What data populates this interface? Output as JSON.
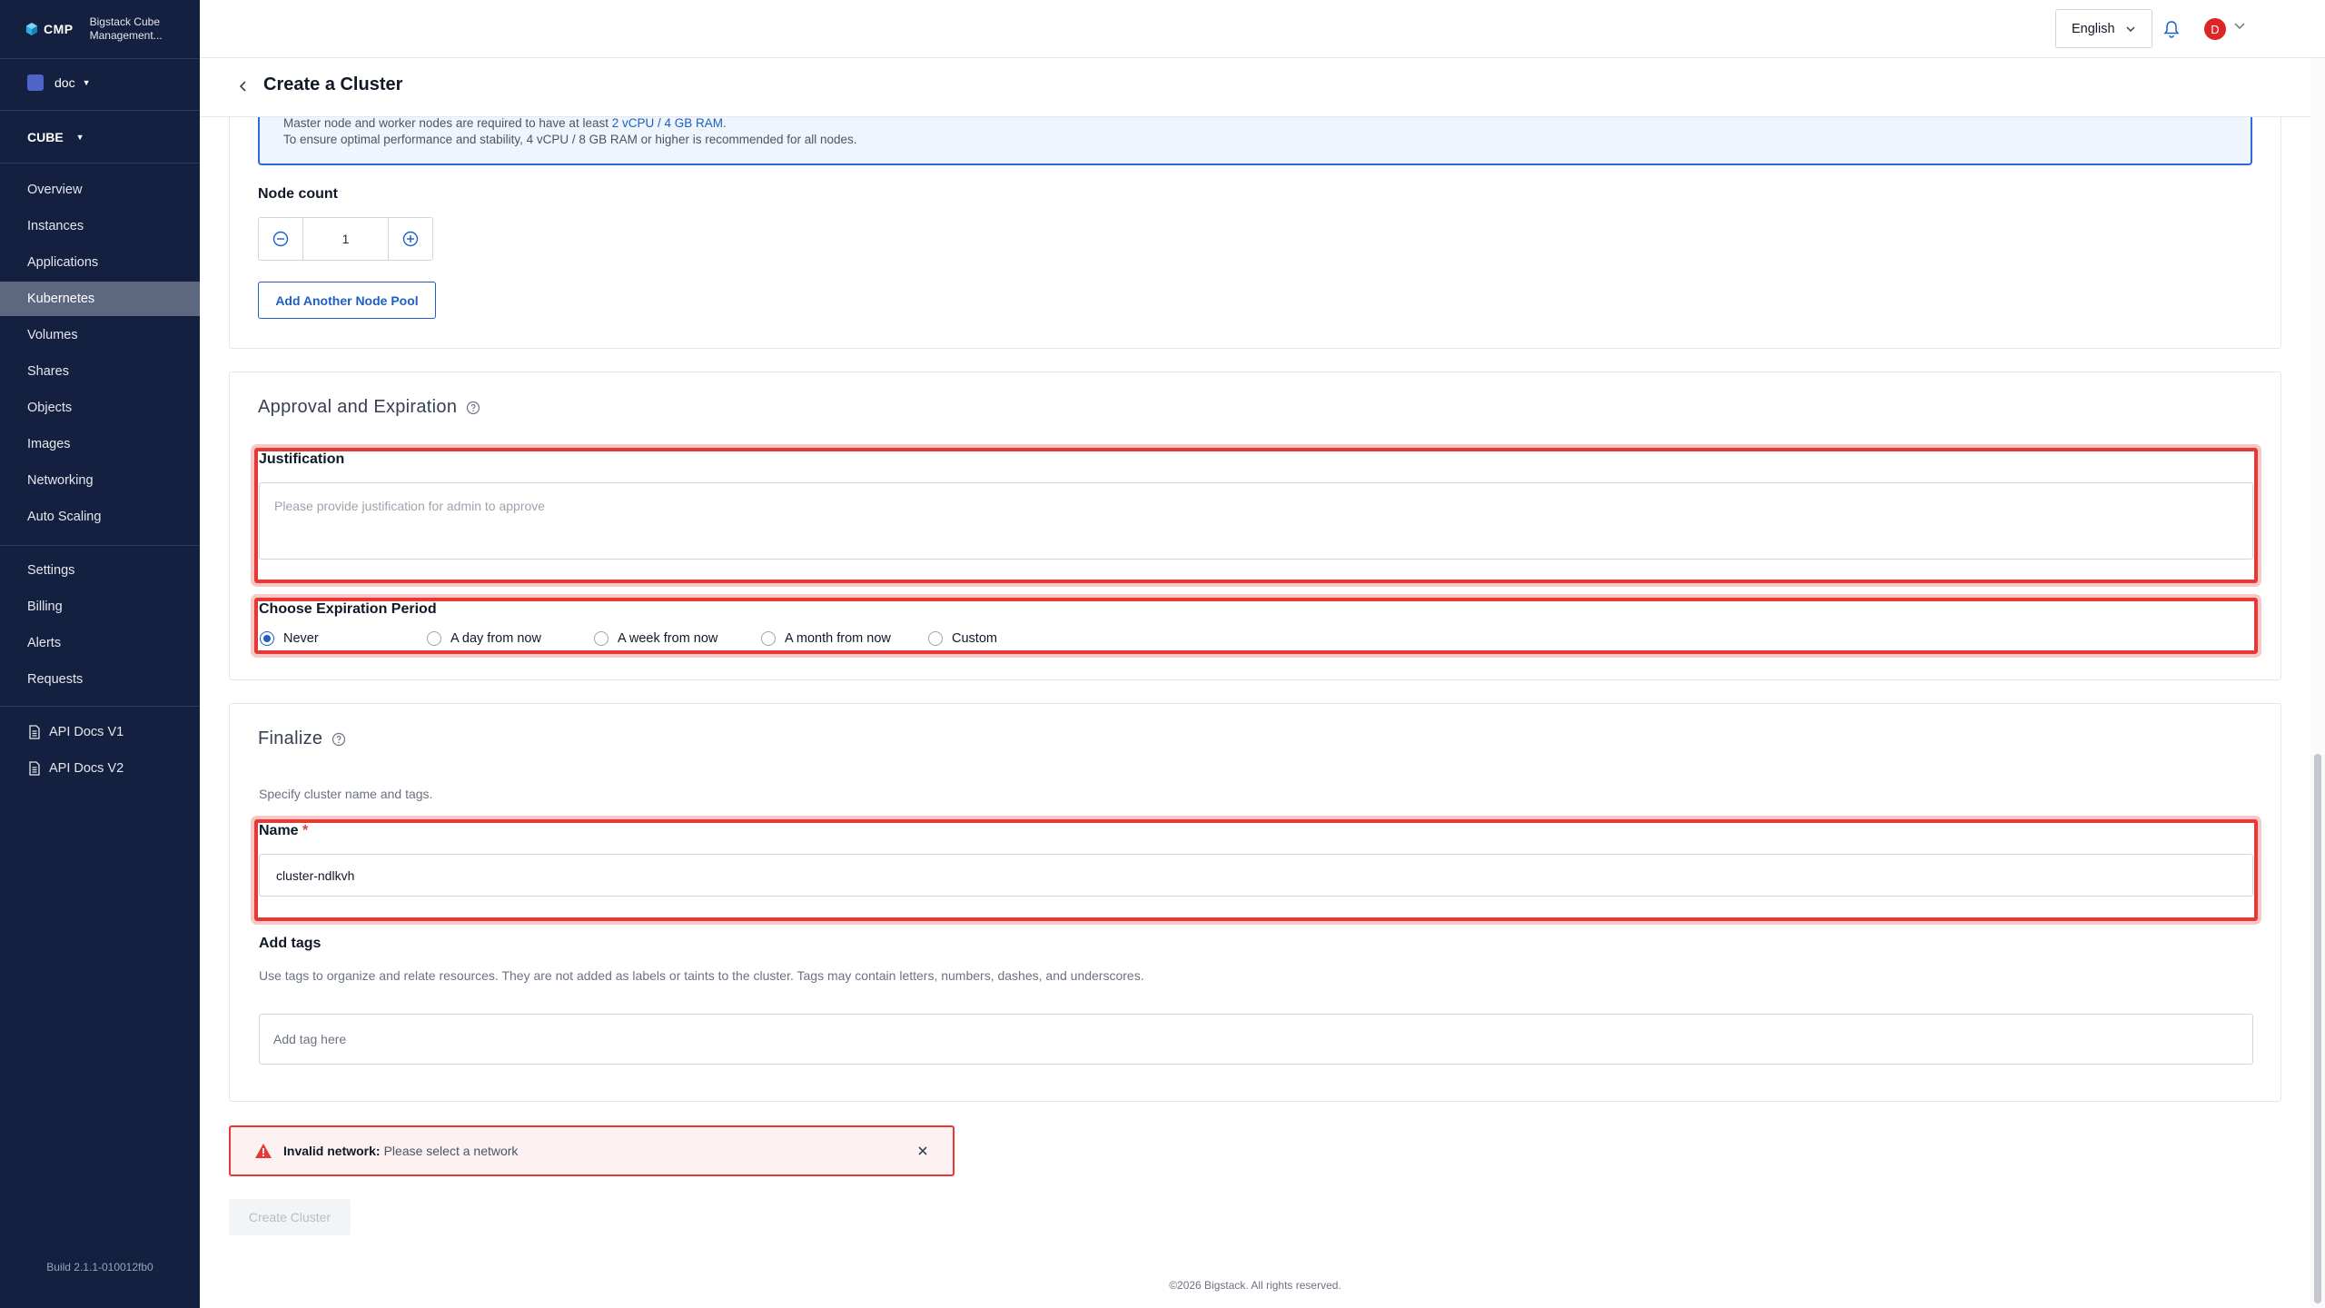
{
  "sidebar": {
    "brand_short": "CMP",
    "brand_name_line1": "Bigstack Cube",
    "brand_name_line2": "Management...",
    "project": "doc",
    "region": "CUBE",
    "nav_main": [
      "Overview",
      "Instances",
      "Applications",
      "Kubernetes",
      "Volumes",
      "Shares",
      "Objects",
      "Images",
      "Networking",
      "Auto Scaling"
    ],
    "active_item": "Kubernetes",
    "nav_admin": [
      "Settings",
      "Billing",
      "Alerts",
      "Requests"
    ],
    "docs": [
      "API Docs V1",
      "API Docs V2"
    ],
    "build": "Build 2.1.1-010012fb0"
  },
  "topbar": {
    "language": "English",
    "avatar_initial": "D"
  },
  "page": {
    "title": "Create a Cluster"
  },
  "node_pool": {
    "info_line1_prefix": "Master node and worker nodes are required to have at least ",
    "info_line1_highlight": "2 vCPU / 4 GB RAM",
    "info_line1_suffix": ".",
    "info_line2": "To ensure optimal performance and stability, 4 vCPU / 8 GB RAM or higher is recommended for all nodes.",
    "node_count_label": "Node count",
    "node_count": "1",
    "add_pool_button": "Add Another Node Pool"
  },
  "approval": {
    "title": "Approval and Expiration",
    "justification_label": "Justification",
    "justification_placeholder": "Please provide justification for admin to approve",
    "expiration_label": "Choose Expiration Period",
    "options": [
      "Never",
      "A day from now",
      "A week from now",
      "A month from now",
      "Custom"
    ],
    "selected": "Never"
  },
  "finalize": {
    "title": "Finalize",
    "description": "Specify cluster name and tags.",
    "name_label": "Name",
    "required_mark": "*",
    "name_value": "cluster-ndlkvh",
    "tags_label": "Add tags",
    "tags_description": "Use tags to organize and relate resources. They are not added as labels or taints to the cluster. Tags may contain letters, numbers, dashes, and underscores.",
    "tags_placeholder": "Add tag here"
  },
  "alert": {
    "title": "Invalid network:",
    "message": "Please select a network"
  },
  "actions": {
    "create_button": "Create Cluster"
  },
  "footer": {
    "copyright": "©2026 Bigstack. All rights reserved."
  },
  "colors": {
    "sidebar_bg": "#13203f",
    "accent": "#1d5fc4",
    "highlight_red": "#e53935"
  }
}
